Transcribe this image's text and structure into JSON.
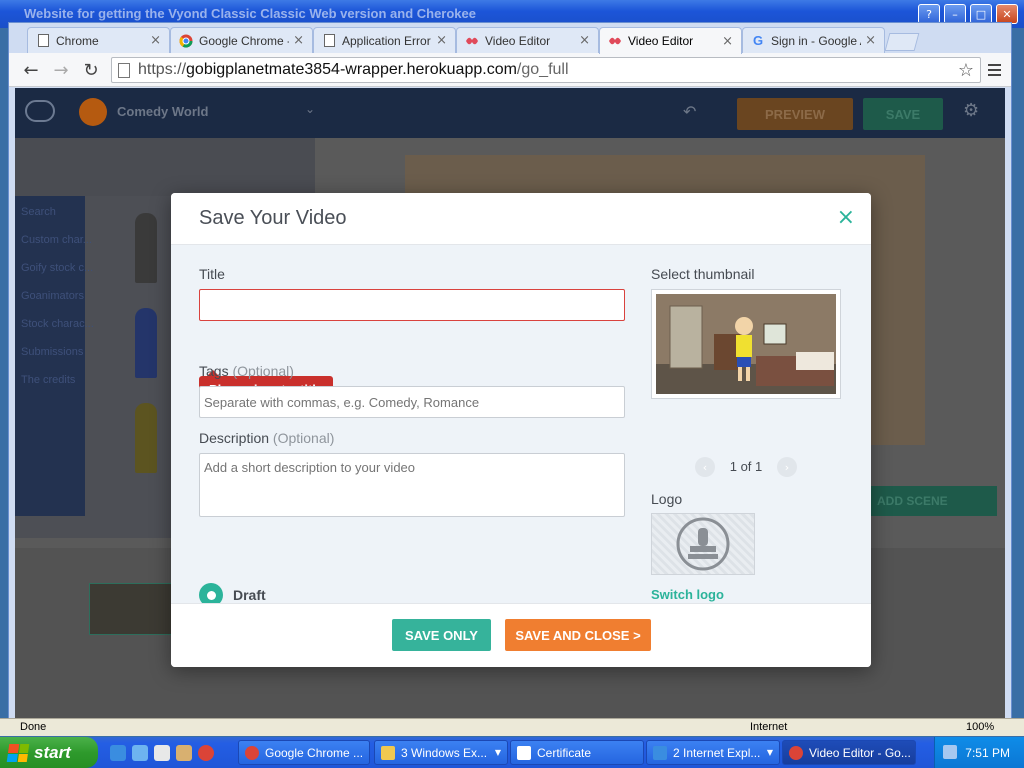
{
  "window": {
    "title": "Website for getting the Vyond Classic Classic Web version and Cherokee",
    "buttons": {
      "help": "?",
      "minimize": "–",
      "maximize": "□",
      "close": "✕"
    }
  },
  "browser": {
    "tabs": [
      {
        "label": "Chrome",
        "icon": "page-icon"
      },
      {
        "label": "Google Chrome - F",
        "icon": "chrome-icon"
      },
      {
        "label": "Application Error",
        "icon": "page-icon"
      },
      {
        "label": "Video Editor",
        "icon": "vyond-icon"
      },
      {
        "label": "Video Editor",
        "icon": "vyond-icon",
        "active": true
      },
      {
        "label": "Sign in - Google A",
        "icon": "google-icon"
      }
    ],
    "url_scheme": "https://",
    "url_host": "gobigplanetmate3854-wrapper.herokuapp.com",
    "url_path": "/go_full"
  },
  "app": {
    "project_name": "Comedy World",
    "preview_label": "PREVIEW",
    "save_label": "SAVE",
    "search_placeholder": "Search",
    "categories": [
      "Custom char...",
      "Goify stock c...",
      "Goanimators",
      "Stock charac...",
      "Submissions",
      "The credits"
    ],
    "add_scene_label": "ADD SCENE"
  },
  "modal": {
    "title": "Save Your Video",
    "close_glyph": "×",
    "title_label": "Title",
    "title_value": "",
    "title_error": "Please input a title",
    "tags_label": "Tags",
    "tags_optional": "(Optional)",
    "tags_placeholder": "Separate with commas, e.g. Comedy, Romance",
    "description_label": "Description",
    "description_optional": "(Optional)",
    "description_placeholder": "Add a short description to your video",
    "draft_label": "Draft",
    "select_thumbnail_label": "Select thumbnail",
    "thumbnail_counter": "1 of 1",
    "logo_label": "Logo",
    "switch_logo_label": "Switch logo",
    "save_only_label": "SAVE ONLY",
    "save_close_label": "SAVE AND CLOSE >"
  },
  "statusbar": {
    "left": "Done",
    "zone": "Internet",
    "zoom": "100%"
  },
  "taskbar": {
    "start_label": "start",
    "tasks": [
      {
        "label": "Google Chrome ...",
        "has_menu": false
      },
      {
        "label": "3 Windows Ex...",
        "has_menu": true
      },
      {
        "label": "Certificate",
        "has_menu": false
      },
      {
        "label": "2 Internet Expl...",
        "has_menu": true
      },
      {
        "label": "Video Editor - Go...",
        "has_menu": false,
        "active": true
      }
    ],
    "clock": "7:51 PM"
  },
  "colors": {
    "accent_green": "#36b39b",
    "accent_orange": "#f07e30",
    "error_red": "#c9302c"
  }
}
